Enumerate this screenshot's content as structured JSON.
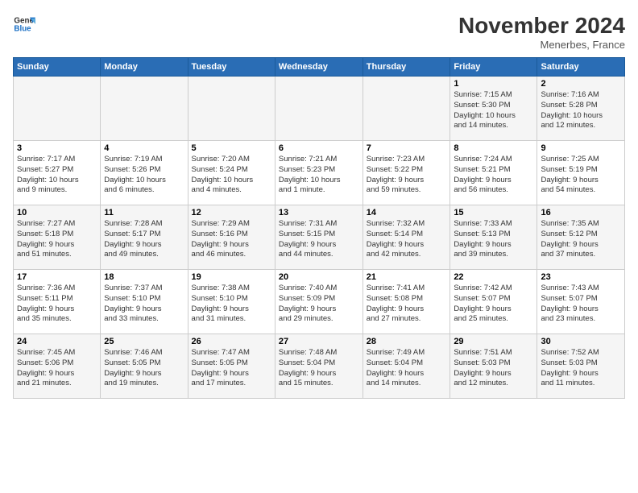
{
  "header": {
    "logo_line1": "General",
    "logo_line2": "Blue",
    "title": "November 2024",
    "location": "Menerbes, France"
  },
  "days_of_week": [
    "Sunday",
    "Monday",
    "Tuesday",
    "Wednesday",
    "Thursday",
    "Friday",
    "Saturday"
  ],
  "weeks": [
    [
      {
        "day": "",
        "info": ""
      },
      {
        "day": "",
        "info": ""
      },
      {
        "day": "",
        "info": ""
      },
      {
        "day": "",
        "info": ""
      },
      {
        "day": "",
        "info": ""
      },
      {
        "day": "1",
        "info": "Sunrise: 7:15 AM\nSunset: 5:30 PM\nDaylight: 10 hours\nand 14 minutes."
      },
      {
        "day": "2",
        "info": "Sunrise: 7:16 AM\nSunset: 5:28 PM\nDaylight: 10 hours\nand 12 minutes."
      }
    ],
    [
      {
        "day": "3",
        "info": "Sunrise: 7:17 AM\nSunset: 5:27 PM\nDaylight: 10 hours\nand 9 minutes."
      },
      {
        "day": "4",
        "info": "Sunrise: 7:19 AM\nSunset: 5:26 PM\nDaylight: 10 hours\nand 6 minutes."
      },
      {
        "day": "5",
        "info": "Sunrise: 7:20 AM\nSunset: 5:24 PM\nDaylight: 10 hours\nand 4 minutes."
      },
      {
        "day": "6",
        "info": "Sunrise: 7:21 AM\nSunset: 5:23 PM\nDaylight: 10 hours\nand 1 minute."
      },
      {
        "day": "7",
        "info": "Sunrise: 7:23 AM\nSunset: 5:22 PM\nDaylight: 9 hours\nand 59 minutes."
      },
      {
        "day": "8",
        "info": "Sunrise: 7:24 AM\nSunset: 5:21 PM\nDaylight: 9 hours\nand 56 minutes."
      },
      {
        "day": "9",
        "info": "Sunrise: 7:25 AM\nSunset: 5:19 PM\nDaylight: 9 hours\nand 54 minutes."
      }
    ],
    [
      {
        "day": "10",
        "info": "Sunrise: 7:27 AM\nSunset: 5:18 PM\nDaylight: 9 hours\nand 51 minutes."
      },
      {
        "day": "11",
        "info": "Sunrise: 7:28 AM\nSunset: 5:17 PM\nDaylight: 9 hours\nand 49 minutes."
      },
      {
        "day": "12",
        "info": "Sunrise: 7:29 AM\nSunset: 5:16 PM\nDaylight: 9 hours\nand 46 minutes."
      },
      {
        "day": "13",
        "info": "Sunrise: 7:31 AM\nSunset: 5:15 PM\nDaylight: 9 hours\nand 44 minutes."
      },
      {
        "day": "14",
        "info": "Sunrise: 7:32 AM\nSunset: 5:14 PM\nDaylight: 9 hours\nand 42 minutes."
      },
      {
        "day": "15",
        "info": "Sunrise: 7:33 AM\nSunset: 5:13 PM\nDaylight: 9 hours\nand 39 minutes."
      },
      {
        "day": "16",
        "info": "Sunrise: 7:35 AM\nSunset: 5:12 PM\nDaylight: 9 hours\nand 37 minutes."
      }
    ],
    [
      {
        "day": "17",
        "info": "Sunrise: 7:36 AM\nSunset: 5:11 PM\nDaylight: 9 hours\nand 35 minutes."
      },
      {
        "day": "18",
        "info": "Sunrise: 7:37 AM\nSunset: 5:10 PM\nDaylight: 9 hours\nand 33 minutes."
      },
      {
        "day": "19",
        "info": "Sunrise: 7:38 AM\nSunset: 5:10 PM\nDaylight: 9 hours\nand 31 minutes."
      },
      {
        "day": "20",
        "info": "Sunrise: 7:40 AM\nSunset: 5:09 PM\nDaylight: 9 hours\nand 29 minutes."
      },
      {
        "day": "21",
        "info": "Sunrise: 7:41 AM\nSunset: 5:08 PM\nDaylight: 9 hours\nand 27 minutes."
      },
      {
        "day": "22",
        "info": "Sunrise: 7:42 AM\nSunset: 5:07 PM\nDaylight: 9 hours\nand 25 minutes."
      },
      {
        "day": "23",
        "info": "Sunrise: 7:43 AM\nSunset: 5:07 PM\nDaylight: 9 hours\nand 23 minutes."
      }
    ],
    [
      {
        "day": "24",
        "info": "Sunrise: 7:45 AM\nSunset: 5:06 PM\nDaylight: 9 hours\nand 21 minutes."
      },
      {
        "day": "25",
        "info": "Sunrise: 7:46 AM\nSunset: 5:05 PM\nDaylight: 9 hours\nand 19 minutes."
      },
      {
        "day": "26",
        "info": "Sunrise: 7:47 AM\nSunset: 5:05 PM\nDaylight: 9 hours\nand 17 minutes."
      },
      {
        "day": "27",
        "info": "Sunrise: 7:48 AM\nSunset: 5:04 PM\nDaylight: 9 hours\nand 15 minutes."
      },
      {
        "day": "28",
        "info": "Sunrise: 7:49 AM\nSunset: 5:04 PM\nDaylight: 9 hours\nand 14 minutes."
      },
      {
        "day": "29",
        "info": "Sunrise: 7:51 AM\nSunset: 5:03 PM\nDaylight: 9 hours\nand 12 minutes."
      },
      {
        "day": "30",
        "info": "Sunrise: 7:52 AM\nSunset: 5:03 PM\nDaylight: 9 hours\nand 11 minutes."
      }
    ]
  ]
}
